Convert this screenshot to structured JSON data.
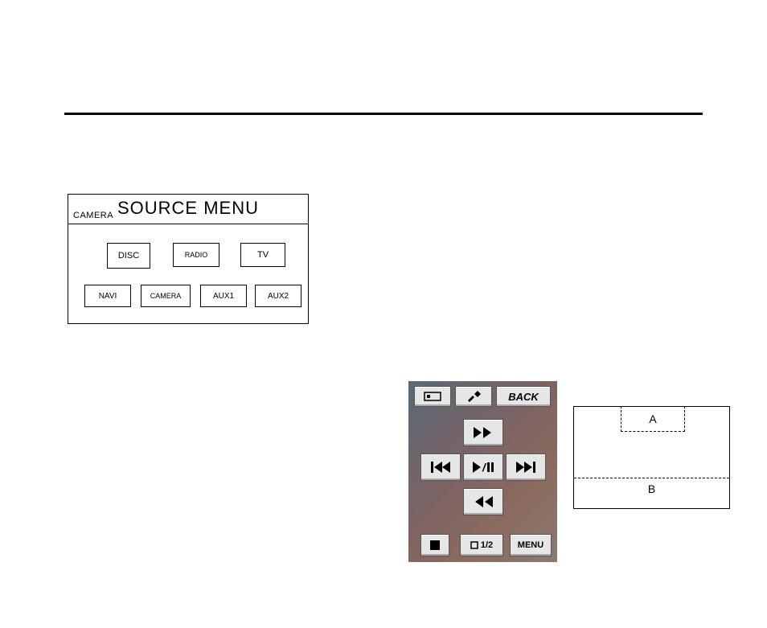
{
  "source_menu": {
    "camera_label": "CAMERA",
    "title": "SOURCE MENU",
    "row1": {
      "disc": "DISC",
      "radio": "RADIO",
      "tv": "TV"
    },
    "row2": {
      "navi": "NAVI",
      "camera": "CAMERA",
      "aux1": "AUX1",
      "aux2": "AUX2"
    }
  },
  "playback": {
    "back": "BACK",
    "page": "1/2",
    "menu": "MENU"
  },
  "ab_diagram": {
    "a": "A",
    "b": "B"
  }
}
